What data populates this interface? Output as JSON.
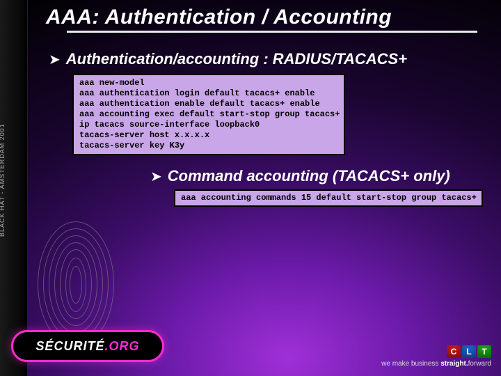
{
  "sidebar": {
    "label": "BLACK HAT - AMSTERDAM 2001"
  },
  "title": "AAA: Authentication / Accounting",
  "bullets": {
    "b1": "Authentication/accounting : RADIUS/TACACS+",
    "b2": "Command accounting (TACACS+ only)"
  },
  "code1": {
    "l1": "aaa new-model",
    "l2": "aaa authentication login default tacacs+ enable",
    "l3": "aaa authentication enable default tacacs+ enable",
    "l4": "aaa accounting exec default start-stop group tacacs+",
    "l5": "ip tacacs source-interface loopback0",
    "l6": "tacacs-server host x.x.x.x",
    "l7": "tacacs-server key K3y"
  },
  "code2": {
    "l1": "aaa accounting commands 15 default start-stop group tacacs+"
  },
  "logo": {
    "part1": "SÉCURITÉ",
    "part2": ".ORG"
  },
  "footer": {
    "c": "C",
    "l": "L",
    "t": "T",
    "tag_pre": "we make business ",
    "tag_bold": "straight.",
    "tag_post": "forward"
  }
}
